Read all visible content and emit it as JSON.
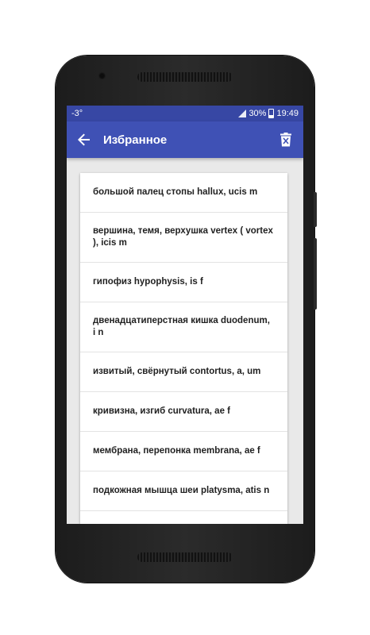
{
  "status_bar": {
    "temperature": "-3°",
    "battery": "30%",
    "time": "19:49"
  },
  "app_bar": {
    "title": "Избранное",
    "back_icon": "arrow-back-icon",
    "delete_icon": "trash-icon"
  },
  "favorites": [
    {
      "text": "большой палец стопы hallux, ucis m"
    },
    {
      "text": "вершина, темя, верхушка vertex ( vortex ), icis m"
    },
    {
      "text": "гипофиз hypophysis, is f"
    },
    {
      "text": "двенадцатиперстная кишка duodenum, i n"
    },
    {
      "text": "извитый, свёрнутый contortus, a, um"
    },
    {
      "text": "кривизна, изгиб curvatura, ae f"
    },
    {
      "text": "мембрана, перепонка membrana, ae f"
    },
    {
      "text": "подкожная мышца шеи platysma, atis n"
    }
  ],
  "colors": {
    "status_bar": "#3747a4",
    "app_bar": "#3f51b5",
    "background": "#e9e9e9",
    "card": "#ffffff"
  }
}
